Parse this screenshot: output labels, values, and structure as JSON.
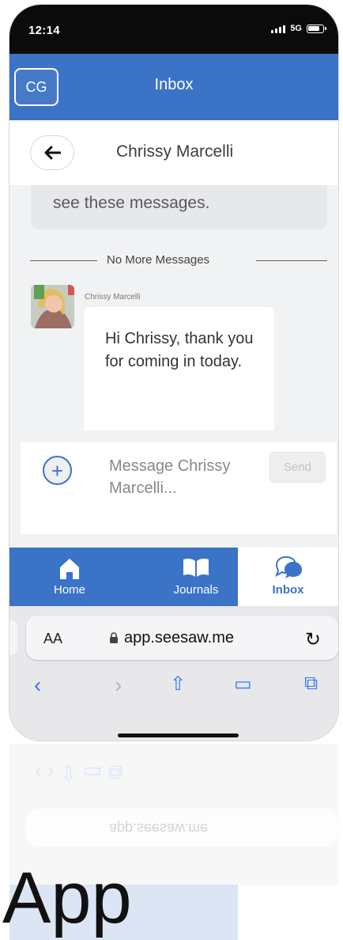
{
  "status_bar": {
    "time": "12:14",
    "network": "5G"
  },
  "header": {
    "avatar_initials": "CG",
    "title": "Inbox"
  },
  "conversation": {
    "name": "Chrissy Marcelli",
    "system_message_fragment": "see these messages.",
    "divider_text": "No More Messages",
    "sender": "Chrissy Marcelli",
    "message": "Hi Chrissy, thank you for coming in today."
  },
  "composer": {
    "placeholder": "Message Chrissy Marcelli...",
    "send_label": "Send"
  },
  "tabs": [
    {
      "label": "Home",
      "icon": "home-icon"
    },
    {
      "label": "Journals",
      "icon": "book-icon"
    },
    {
      "label": "Inbox",
      "icon": "chat-bubble-icon",
      "active": true
    }
  ],
  "browser": {
    "text_size": "AA",
    "url": "app.seesaw.me",
    "controls": [
      "back-icon",
      "forward-icon",
      "share-icon",
      "bookmarks-icon",
      "tabs-icon"
    ]
  },
  "colors": {
    "accent": "#3b73c7",
    "browser_blue": "#3478f6"
  },
  "app_label": "App"
}
